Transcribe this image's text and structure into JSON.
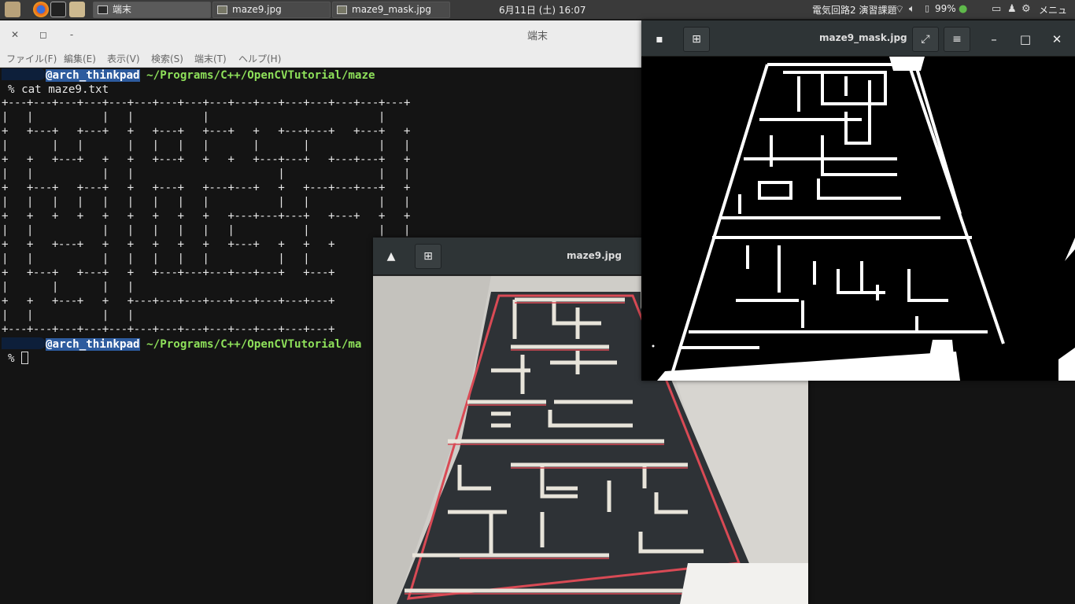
{
  "panel": {
    "tasks": [
      {
        "label": "端末"
      },
      {
        "label": "maze9.jpg"
      },
      {
        "label": "maze9_mask.jpg"
      }
    ],
    "clock": "6月11日 (土) 16:07",
    "tray_text": "電気回路2 演習課題",
    "battery": "99%",
    "menu": "メニュー"
  },
  "terminal": {
    "title": "端末",
    "menus": [
      "ファイル(F)",
      "編集(E)",
      "表示(V)",
      "検索(S)",
      "端末(T)",
      "ヘルプ(H)"
    ],
    "prompt_user": "@arch_thinkpad",
    "prompt_path": "~/Programs/C++/OpenCVTutorial/maze",
    "prompt_path_2": "~/Programs/C++/OpenCVTutorial/ma",
    "command": "% cat maze9.txt",
    "prompt_symbol": "%",
    "maze_lines": [
      "+---+---+---+---+---+---+---+---+---+---+---+---+---+---+---+---+",
      "|   |           |   |           |                           |",
      "+   +---+   +---+   +   +---+   +---+   +   +---+---+   +---+   +",
      "|       |   |       |   |   |   |       |       |           |   |",
      "+   +   +---+   +   +   +---+   +   +   +---+---+   +---+---+   +",
      "|   |           |   |                       |               |   |",
      "+   +---+   +---+   +   +---+   +---+---+   +   +---+---+---+   +",
      "|   |   |   |   |   |   |   |   |           |   |           |   |",
      "+   +   +   +   +   +   +   +   +   +---+---+---+   +---+   +   +",
      "|   |           |   |   |   |   |   |           |           |   |",
      "+   +   +---+   +   +   +   +   +   +---+   +   +   +",
      "|   |           |   |   |   |   |           |   |",
      "+   +---+   +---+   +   +---+---+---+---+---+   +---+",
      "|       |       |   |",
      "+   +   +---+   +   +---+---+---+---+---+---+---+---+",
      "|   |           |   |",
      "+---+---+---+---+---+---+---+---+---+---+---+---+---+"
    ]
  },
  "viewer_photo": {
    "title": "maze9.jpg"
  },
  "viewer_mask": {
    "title": "maze9_mask.jpg"
  }
}
